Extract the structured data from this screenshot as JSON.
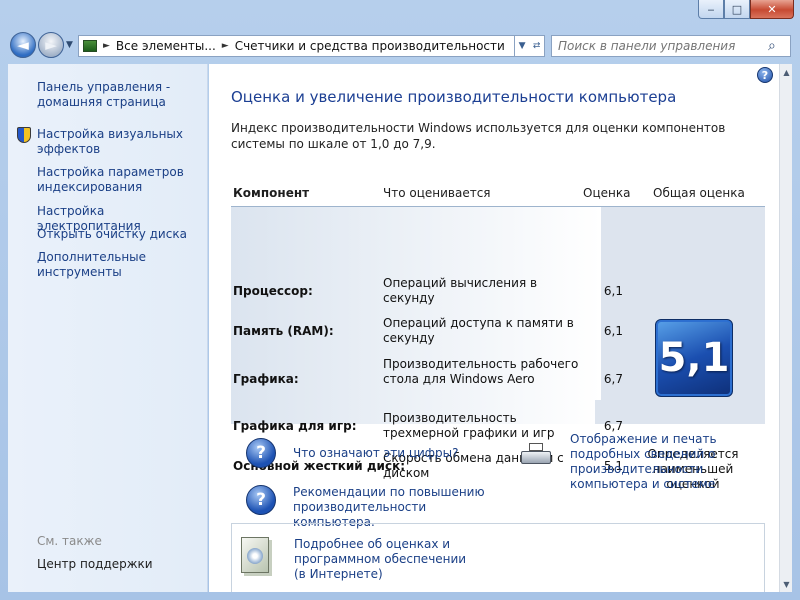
{
  "window": {
    "controls": {
      "minimize": "‒",
      "maximize": "□",
      "close": "✕"
    }
  },
  "nav": {
    "back_icon": "◄",
    "forward_icon": "►",
    "history_icon": "▼",
    "breadcrumbs": [
      "Все элементы...",
      "Счетчики и средства производительности"
    ],
    "breadcrumb_sep": "►",
    "dropdown_icon": "▼",
    "refresh_icon": "⇄",
    "search": {
      "placeholder": "Поиск в панели управления",
      "icon": "⌕"
    }
  },
  "sidebar": {
    "items": [
      {
        "label": "Панель управления - домашняя страница"
      },
      {
        "label": "Настройка визуальных эффектов",
        "icon": "shield-icon"
      },
      {
        "label": "Настройка параметров индексирования"
      },
      {
        "label": "Настройка электропитания"
      },
      {
        "label": "Открыть очистку диска"
      },
      {
        "label": "Дополнительные инструменты"
      }
    ],
    "see_also_label": "См. также",
    "see_also_items": [
      {
        "label": "Центр поддержки"
      }
    ]
  },
  "main": {
    "help_icon": "?",
    "title": "Оценка и увеличение производительности компьютера",
    "description": "Индекс производительности Windows используется для оценки компонентов системы по шкале от 1,0 до 7,9.",
    "table": {
      "headers": {
        "component": "Компонент",
        "rated": "Что оценивается",
        "score": "Оценка",
        "overall": "Общая оценка"
      },
      "rows": [
        {
          "component": "Процессор:",
          "rated": "Операций вычисления в секунду",
          "score": "6,1"
        },
        {
          "component": "Память (RAM):",
          "rated": "Операций доступа к памяти в секунду",
          "score": "6,1"
        },
        {
          "component": "Графика:",
          "rated": "Производительность рабочего стола для Windows Aero",
          "score": "6,7"
        },
        {
          "component": "Графика для игр:",
          "rated": "Производительность трехмерной графики и игр",
          "score": "6,7"
        },
        {
          "component": "Основной жесткий диск:",
          "rated": "Скорость обмена данными с диском",
          "score": "5,1"
        }
      ],
      "overall_score": "5,1",
      "overall_note": "Определяется наименьшей оценкой"
    },
    "links": {
      "what_numbers_mean": "Что означают эти цифры?",
      "recommendations": "Рекомендации по повышению производительности компьютера.",
      "print_details": "Отображение и печать подробных сведений о производительности компьютера и системе",
      "more_online": "Подробнее об оценках и программном обеспечении (в Интернете)"
    },
    "question_icon": "?"
  }
}
